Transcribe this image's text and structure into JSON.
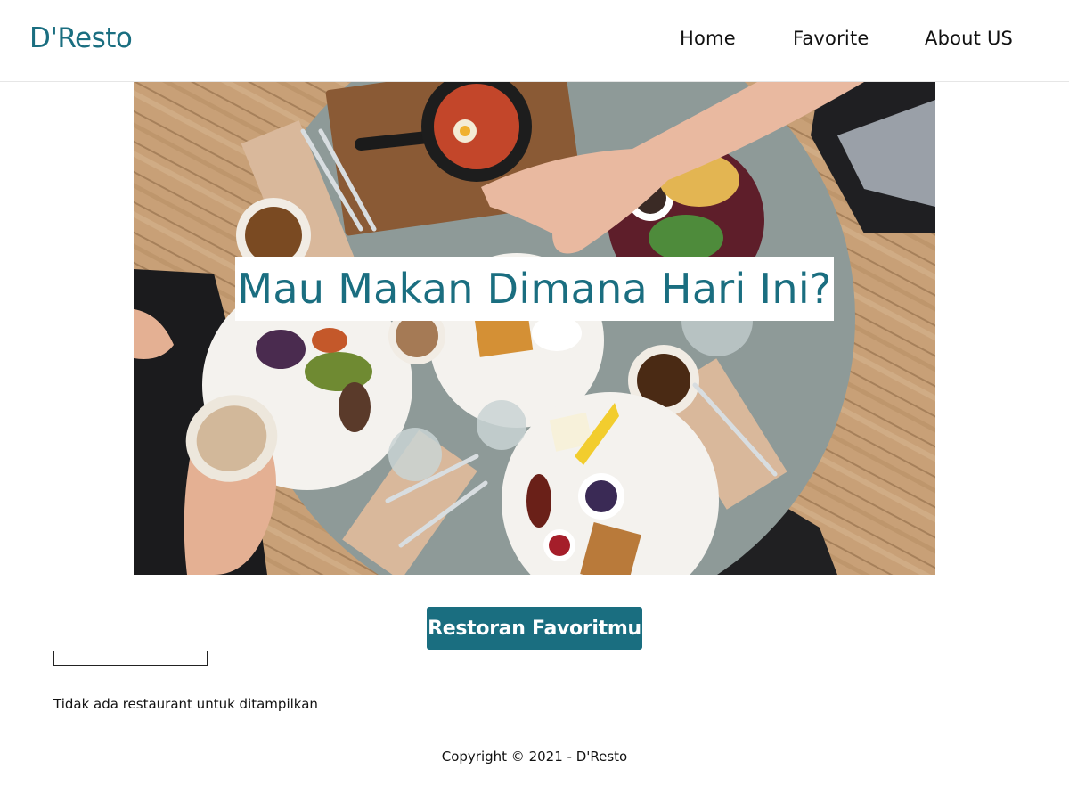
{
  "colors": {
    "brand": "#1a6e80",
    "button_bg": "#1a6e80",
    "text": "#111111",
    "table": "#8e9a98",
    "floor": "#c79a6a"
  },
  "header": {
    "brand": "D'Resto",
    "nav": [
      "Home",
      "Favorite",
      "About US"
    ]
  },
  "hero": {
    "title": "Mau Makan Dimana Hari Ini?",
    "image": "restaurant-table-food-photo"
  },
  "section": {
    "button_label": "Restoran Favoritmu",
    "search_value": "",
    "empty_message": "Tidak ada restaurant untuk ditampilkan"
  },
  "footer": {
    "copyright": "Copyright © 2021 - D'Resto"
  }
}
